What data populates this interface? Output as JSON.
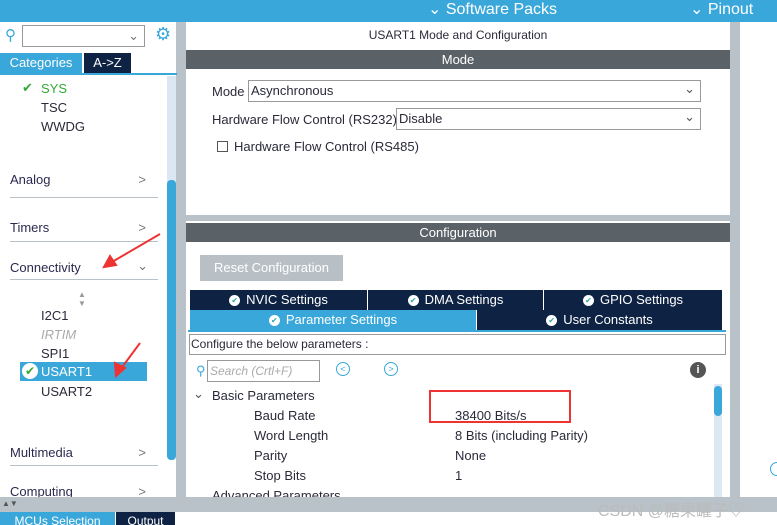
{
  "topbar": {
    "software_packs": "Software Packs",
    "pinout": "Pinout"
  },
  "left": {
    "tabs": [
      "Categories",
      "A->Z"
    ],
    "system_items": [
      "SYS",
      "TSC",
      "WWDG"
    ],
    "sections": {
      "analog": "Analog",
      "timers": "Timers",
      "connectivity": "Connectivity",
      "multimedia": "Multimedia",
      "computing": "Computing"
    },
    "connectivity_items": [
      "I2C1",
      "IRTIM",
      "SPI1",
      "USART1",
      "USART2"
    ]
  },
  "main": {
    "title": "USART1 Mode and Configuration",
    "mode_header": "Mode",
    "mode_label": "Mode",
    "mode_value": "Asynchronous",
    "hfc232_label": "Hardware Flow Control (RS232)",
    "hfc232_value": "Disable",
    "hfc485_label": "Hardware Flow Control (RS485)",
    "config_header": "Configuration",
    "reset_button": "Reset Configuration",
    "tabs": [
      "NVIC Settings",
      "DMA Settings",
      "GPIO Settings",
      "Parameter Settings",
      "User Constants"
    ],
    "configure_text": "Configure the below parameters :",
    "search_placeholder": "Search (Crtl+F)",
    "group": "Basic Parameters",
    "params": [
      {
        "name": "Baud Rate",
        "value": "38400 Bits/s"
      },
      {
        "name": "Word Length",
        "value": "8 Bits (including Parity)"
      },
      {
        "name": "Parity",
        "value": "None"
      },
      {
        "name": "Stop Bits",
        "value": "1"
      }
    ],
    "next_group": "Advanced Parameters"
  },
  "bottom": {
    "tabs": [
      "MCUs Selection",
      "Output"
    ]
  },
  "watermark": "CSDN @糖果罐子♡",
  "colors": {
    "accent": "#3aa7da",
    "dark": "#0e2343",
    "highlight": "#e33"
  }
}
